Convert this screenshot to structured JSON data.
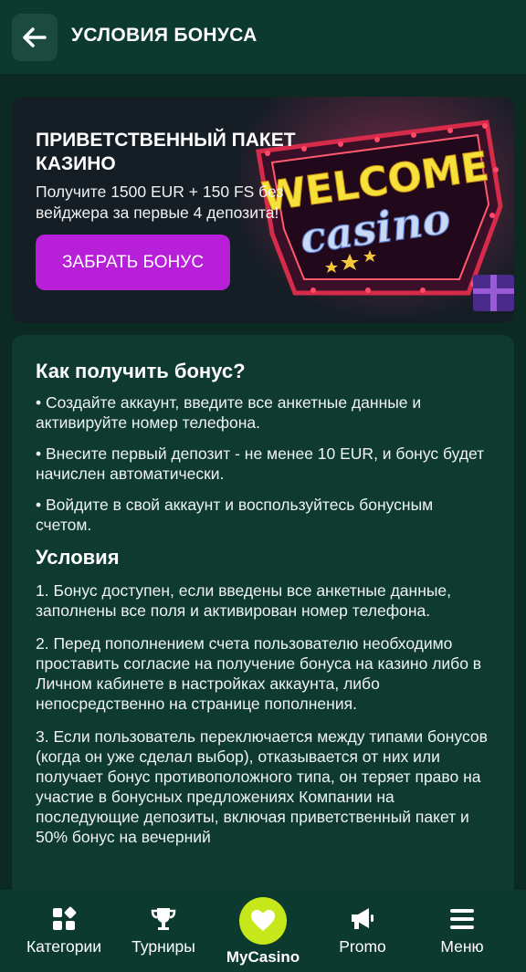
{
  "header": {
    "back_icon": "arrow-left-icon",
    "title": "УСЛОВИЯ БОНУСА"
  },
  "promo": {
    "title": "ПРИВЕТСТВЕННЫЙ ПАКЕТ КАЗИНО",
    "subtitle": "Получите 1500 EUR + 150 FS без вейджера за первые 4 депозита!",
    "button_label": "ЗАБРАТЬ БОНУС",
    "art_text_1": "WELCOME",
    "art_text_2": "casino"
  },
  "how_to": {
    "heading": "Как получить бонус?",
    "items": [
      "• Создайте аккаунт, введите все анкетные данные и активируйте номер телефона.",
      "• Внесите первый депозит - не менее 10 EUR, и бонус будет начислен автоматически.",
      "• Войдите в свой аккаунт и воспользуйтесь бонусным счетом."
    ]
  },
  "conditions": {
    "heading": "Условия",
    "items": [
      "1. Бонус доступен, если введены все анкетные данные, заполнены все поля и активирован номер телефона.",
      "2. Перед пополнением счета пользователю необходимо проставить согласие на получение бонуса на казино либо в Личном кабинете в настройках аккаунта, либо непосредственно на странице пополнения.",
      "3. Если пользователь переключается между типами бонусов (когда он уже сделал выбор), отказывается от них или получает бонус противоположного типа, он теряет право на участие в бонусных предложениях Компании на последующие депозиты, включая приветственный пакет и 50% бонус на вечерний"
    ]
  },
  "nav": {
    "items": [
      {
        "label": "Категории",
        "icon": "categories-icon"
      },
      {
        "label": "Турниры",
        "icon": "trophy-icon"
      },
      {
        "label": "MyCasino",
        "icon": "heart-icon"
      },
      {
        "label": "Promo",
        "icon": "megaphone-icon"
      },
      {
        "label": "Меню",
        "icon": "hamburger-menu-icon"
      }
    ]
  },
  "colors": {
    "background": "#0b2a22",
    "header": "#0d3a2f",
    "card": "#0f3a30",
    "promo_button": "#b81fd8",
    "mycasino_accent": "#c6e81a"
  }
}
